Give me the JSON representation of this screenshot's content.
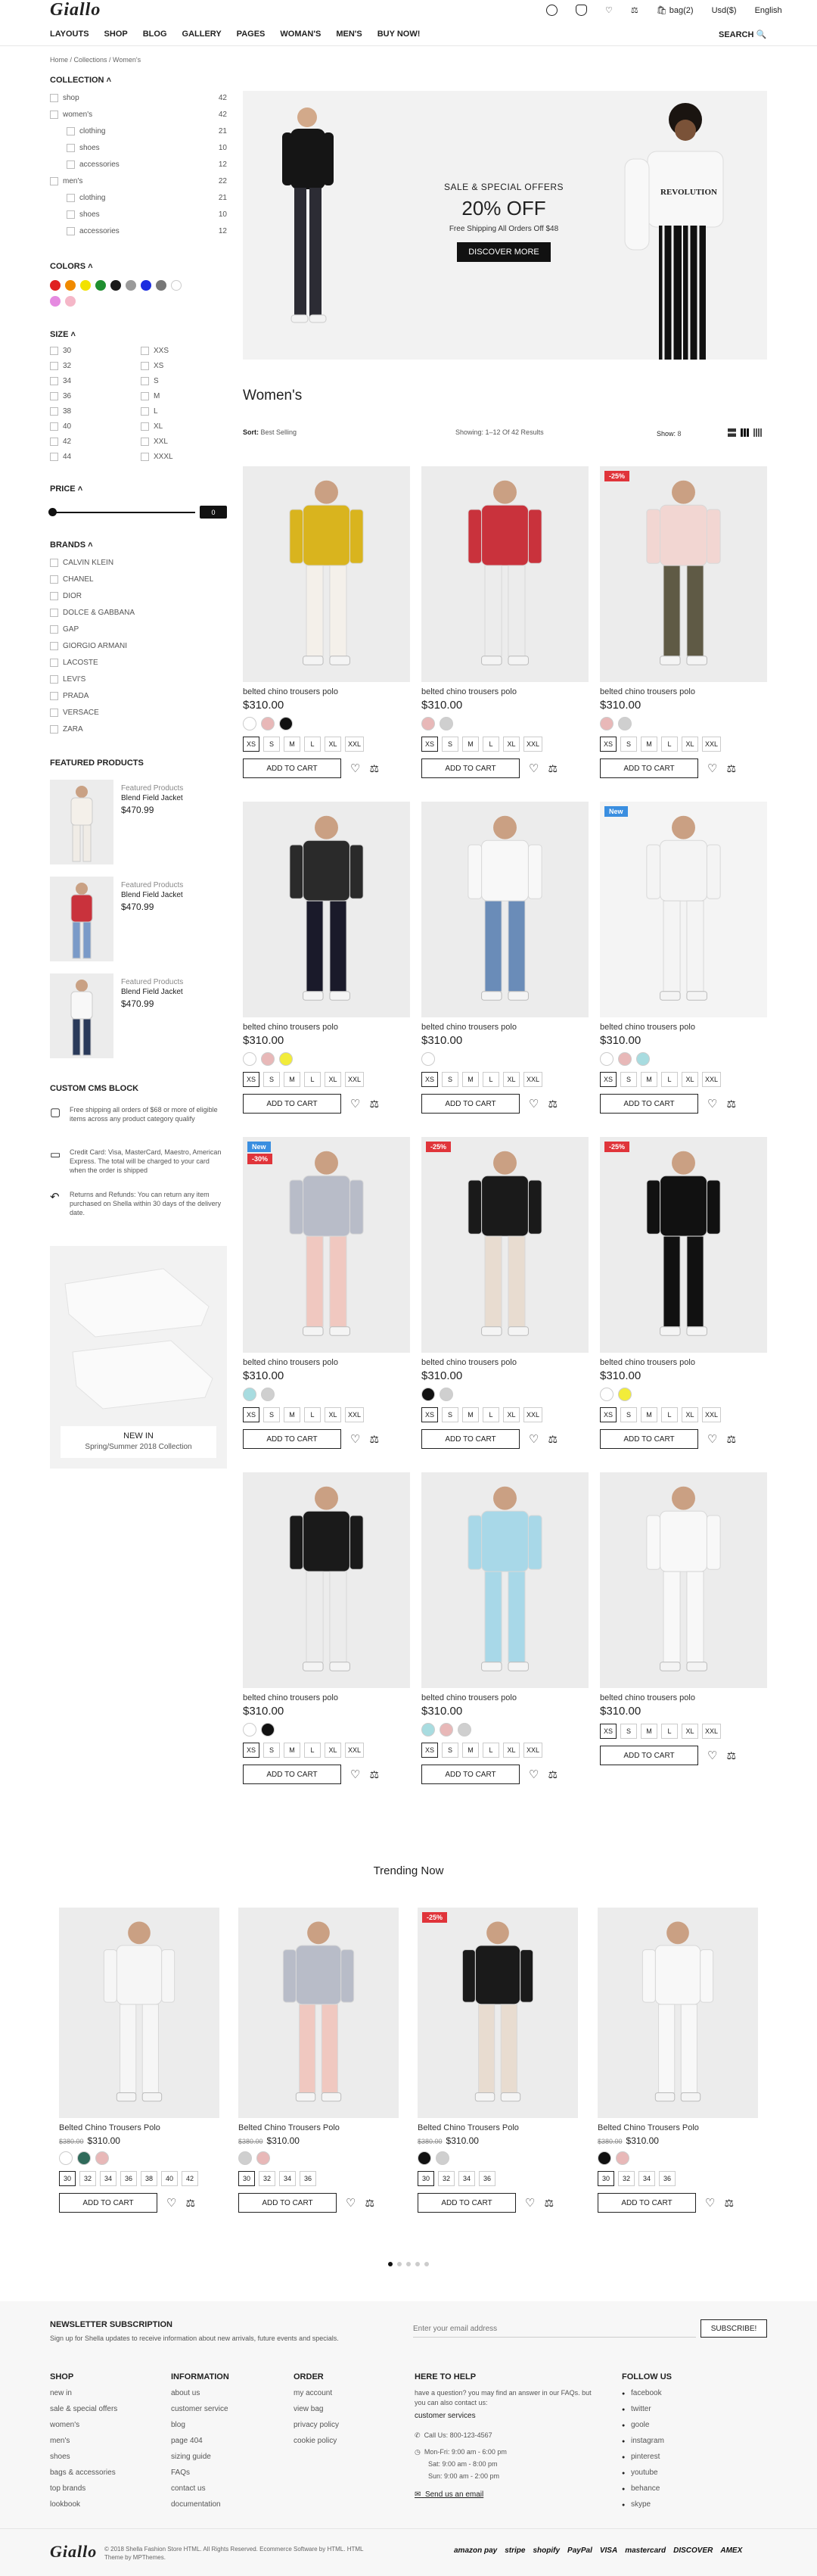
{
  "header": {
    "logo": "Giallo",
    "nav": [
      "LAYOUTS",
      "SHOP",
      "BLOG",
      "GALLERY",
      "PAGES",
      "WOMAN'S",
      "MEN'S",
      "BUY NOW!"
    ],
    "bag": "bag(2)",
    "currency": "Usd($)",
    "language": "English",
    "search": "SEARCH"
  },
  "breadcrumb": "Home / Collections / Women's",
  "sidebar": {
    "collection_title": "COLLECTION",
    "collection": [
      {
        "label": "shop",
        "count": "42",
        "level": 0
      },
      {
        "label": "women's",
        "count": "42",
        "level": 0
      },
      {
        "label": "clothing",
        "count": "21",
        "level": 1
      },
      {
        "label": "shoes",
        "count": "10",
        "level": 1
      },
      {
        "label": "accessories",
        "count": "12",
        "level": 1
      },
      {
        "label": "men's",
        "count": "22",
        "level": 0
      },
      {
        "label": "clothing",
        "count": "21",
        "level": 1
      },
      {
        "label": "shoes",
        "count": "10",
        "level": 1
      },
      {
        "label": "accessories",
        "count": "12",
        "level": 1
      }
    ],
    "colors_title": "COLORS",
    "colors": [
      "#e02020",
      "#f08a00",
      "#f2e200",
      "#1f8f2f",
      "#1a1a1a",
      "#9a9a9a",
      "#1c2ee0",
      "#777777",
      "#ffffff",
      "#e58ae0",
      "#f5b7c8"
    ],
    "size_title": "SIZE",
    "sizes_left": [
      "30",
      "32",
      "34",
      "36",
      "38",
      "40",
      "42",
      "44"
    ],
    "sizes_right": [
      "XXS",
      "XS",
      "S",
      "M",
      "L",
      "XL",
      "XXL",
      "XXXL"
    ],
    "price_title": "PRICE",
    "price_value": "0",
    "brands_title": "BRANDS",
    "brands": [
      "CALVIN KLEIN",
      "CHANEL",
      "DIOR",
      "DOLCE & GABBANA",
      "GAP",
      "GIORGIO ARMANI",
      "LACOSTE",
      "LEVI'S",
      "PRADA",
      "VERSACE",
      "ZARA"
    ],
    "featured_title": "FEATURED PRODUCTS",
    "featured": [
      {
        "cat": "Featured Products",
        "name": "Blend Field Jacket",
        "price": "$470.99"
      },
      {
        "cat": "Featured Products",
        "name": "Blend Field Jacket",
        "price": "$470.99"
      },
      {
        "cat": "Featured Products",
        "name": "Blend Field Jacket",
        "price": "$470.99"
      }
    ],
    "cms_title": "CUSTOM CMS BLOCK",
    "cms": [
      "Free shipping all orders of $68 or more of eligible items across any product category qualify",
      "Credit Card: Visa, MasterCard, Maestro, American Express. The total will be charged to your card when the order is shipped",
      "Returns and Refunds: You can return any item purchased on Shella within 30 days of the delivery date."
    ],
    "promo_title": "NEW IN",
    "promo_sub": "Spring/Summer 2018 Collection"
  },
  "hero": {
    "kicker": "SALE & SPECIAL OFFERS",
    "headline": "20% OFF",
    "sub": "Free Shipping All Orders Off $48",
    "button": "DISCOVER MORE",
    "shirt_text": "REVOLUTION"
  },
  "listing": {
    "title": "Women's",
    "sort_label": "Sort:",
    "sort_value": "Best Selling",
    "showing": "Showing: 1–12 Of 42 Results",
    "show_label": "Show:",
    "show_value": "8"
  },
  "products": [
    {
      "title": "belted chino trousers polo",
      "price": "$310.00",
      "colors": [
        "#ffffff",
        "#e8b8b8",
        "#111111"
      ],
      "sizes": [
        "XS",
        "S",
        "M",
        "L",
        "XL",
        "XXL"
      ],
      "badge": "",
      "img": "#ececec",
      "shirt": "#d9b41e",
      "pants": "#f4f0ea"
    },
    {
      "title": "belted chino trousers polo",
      "price": "$310.00",
      "colors": [
        "#e8b8b8",
        "#cfcfcf"
      ],
      "sizes": [
        "XS",
        "S",
        "M",
        "L",
        "XL",
        "XXL"
      ],
      "badge": "",
      "img": "#ececec",
      "shirt": "#c9323c",
      "pants": "#ececec"
    },
    {
      "title": "belted chino trousers polo",
      "price": "$310.00",
      "colors": [
        "#e8b8b8",
        "#cfcfcf"
      ],
      "sizes": [
        "XS",
        "S",
        "M",
        "L",
        "XL",
        "XXL"
      ],
      "badge": "-25%",
      "img": "#ececec",
      "shirt": "#f2d6d2",
      "pants": "#5f5a45"
    },
    {
      "title": "belted chino trousers polo",
      "price": "$310.00",
      "colors": [
        "#ffffff",
        "#e8b8b8",
        "#f2ec3a"
      ],
      "sizes": [
        "XS",
        "S",
        "M",
        "L",
        "XL",
        "XXL"
      ],
      "badge": "",
      "img": "#ececec",
      "shirt": "#2a2a2a",
      "pants": "#1a1a2a"
    },
    {
      "title": "belted chino trousers polo",
      "price": "$310.00",
      "colors": [
        "#ffffff"
      ],
      "sizes": [
        "XS",
        "S",
        "M",
        "L",
        "XL",
        "XXL"
      ],
      "badge": "",
      "img": "#ececec",
      "shirt": "#f8f8f8",
      "pants": "#6a8cb8"
    },
    {
      "title": "belted chino trousers polo",
      "price": "$310.00",
      "colors": [
        "#ffffff",
        "#e8b8b8",
        "#a8dce0"
      ],
      "sizes": [
        "XS",
        "S",
        "M",
        "L",
        "XL",
        "XXL"
      ],
      "badge": "New",
      "img": "#f4f4f4",
      "shirt": "#f4f4f4",
      "pants": "#f4f4f4"
    },
    {
      "title": "belted chino trousers polo",
      "price": "$310.00",
      "colors": [
        "#a8dce0",
        "#cfcfcf"
      ],
      "sizes": [
        "XS",
        "S",
        "M",
        "L",
        "XL",
        "XXL"
      ],
      "badge": "New|-30%",
      "img": "#ececec",
      "shirt": "#b8bcc8",
      "pants": "#f0c8c0"
    },
    {
      "title": "belted chino trousers polo",
      "price": "$310.00",
      "colors": [
        "#111111",
        "#cfcfcf"
      ],
      "sizes": [
        "XS",
        "S",
        "M",
        "L",
        "XL",
        "XXL"
      ],
      "badge": "-25%",
      "img": "#ececec",
      "shirt": "#1a1a1a",
      "pants": "#e8dcd0"
    },
    {
      "title": "belted chino trousers polo",
      "price": "$310.00",
      "colors": [
        "#ffffff",
        "#f2ec3a"
      ],
      "sizes": [
        "XS",
        "S",
        "M",
        "L",
        "XL",
        "XXL"
      ],
      "badge": "-25%",
      "img": "#ececec",
      "shirt": "#111111",
      "pants": "#111111"
    },
    {
      "title": "belted chino trousers polo",
      "price": "$310.00",
      "colors": [
        "#ffffff",
        "#111111"
      ],
      "sizes": [
        "XS",
        "S",
        "M",
        "L",
        "XL",
        "XXL"
      ],
      "badge": "",
      "img": "#ececec",
      "shirt": "#1a1a1a",
      "pants": "#ececec"
    },
    {
      "title": "belted chino trousers polo",
      "price": "$310.00",
      "colors": [
        "#a8dce0",
        "#e8b8b8",
        "#cfcfcf"
      ],
      "sizes": [
        "XS",
        "S",
        "M",
        "L",
        "XL",
        "XXL"
      ],
      "badge": "",
      "img": "#ececec",
      "shirt": "#a8d8e8",
      "pants": "#a8d8e8"
    },
    {
      "title": "belted chino trousers polo",
      "price": "$310.00",
      "colors": [],
      "sizes": [
        "XS",
        "S",
        "M",
        "L",
        "XL",
        "XXL"
      ],
      "badge": "",
      "img": "#ececec",
      "shirt": "#f8f8f8",
      "pants": "#f8f8f8"
    }
  ],
  "trending": {
    "title": "Trending Now",
    "items": [
      {
        "title": "Belted Chino Trousers Polo",
        "old": "$380.00",
        "price": "$310.00",
        "colors": [
          "#ffffff",
          "#2f6a5a",
          "#e8b8b8"
        ],
        "sizes": [
          "30",
          "32",
          "34",
          "36",
          "38",
          "40",
          "42"
        ],
        "badge": "",
        "shirt": "#f6f6f6",
        "pants": "#f6f6f6"
      },
      {
        "title": "Belted Chino Trousers Polo",
        "old": "$380.00",
        "price": "$310.00",
        "colors": [
          "#cfcfcf",
          "#e8b8b8"
        ],
        "sizes": [
          "30",
          "32",
          "34",
          "36"
        ],
        "badge": "",
        "shirt": "#b8bcc8",
        "pants": "#f0c8c0"
      },
      {
        "title": "Belted Chino Trousers Polo",
        "old": "$380.00",
        "price": "$310.00",
        "colors": [
          "#111111",
          "#cfcfcf"
        ],
        "sizes": [
          "30",
          "32",
          "34",
          "36"
        ],
        "badge": "-25%",
        "shirt": "#1a1a1a",
        "pants": "#e8dcd0"
      },
      {
        "title": "Belted Chino Trousers Polo",
        "old": "$380.00",
        "price": "$310.00",
        "colors": [
          "#111111",
          "#e8b8b8"
        ],
        "sizes": [
          "30",
          "32",
          "34",
          "36"
        ],
        "badge": "",
        "shirt": "#f8f8f8",
        "pants": "#f8f8f8"
      }
    ]
  },
  "newsletter": {
    "title": "NEWSLETTER SUBSCRIPTION",
    "desc": "Sign up for Shella updates to receive information about new arrivals, future events and specials.",
    "placeholder": "Enter your email address",
    "button": "SUBSCRIBE!"
  },
  "footer": {
    "shop_title": "SHOP",
    "shop": [
      "new in",
      "sale & special offers",
      "women's",
      "men's",
      "shoes",
      "bags & accessories",
      "top brands",
      "lookbook"
    ],
    "info_title": "INFORMATION",
    "info": [
      "about us",
      "customer service",
      "blog",
      "page 404",
      "sizing guide",
      "FAQs",
      "contact us",
      "documentation"
    ],
    "order_title": "ORDER",
    "order": [
      "my account",
      "view bag",
      "privacy policy",
      "cookie policy"
    ],
    "help_title": "HERE TO HELP",
    "help_text": "have a question? you may find an answer in our FAQs. but you can also contact us:",
    "help_service": "customer services",
    "help_phone": "Call Us: 800-123-4567",
    "help_hours": [
      "Mon-Fri: 9:00 am - 6:00 pm",
      "Sat: 9:00 am - 8:00 pm",
      "Sun: 9:00 am - 2:00 pm"
    ],
    "help_email": "Send us an email",
    "follow_title": "FOLLOW US",
    "follow": [
      "facebook",
      "twitter",
      "goole",
      "instagram",
      "pinterest",
      "youtube",
      "behance",
      "skype"
    ],
    "copyright": "© 2018 Shella Fashion Store HTML. All Rights Reserved. Ecommerce Software by HTML. HTML Theme by MPThemes.",
    "logo": "Giallo",
    "payments": [
      "amazon pay",
      "stripe",
      "shopify",
      "PayPal",
      "VISA",
      "mastercard",
      "DISCOVER",
      "AMEX"
    ]
  }
}
